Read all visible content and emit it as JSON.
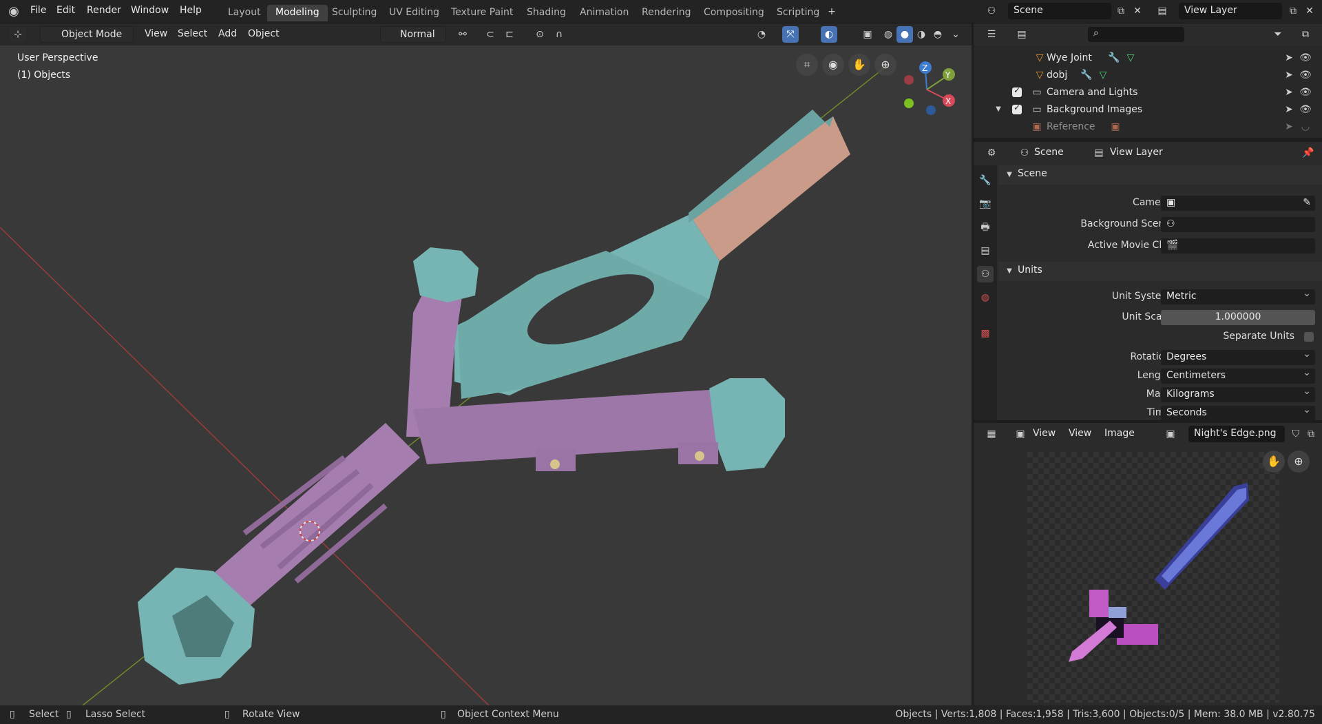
{
  "topbar": {
    "menus": [
      "File",
      "Edit",
      "Render",
      "Window",
      "Help"
    ],
    "workspaces": [
      "Layout",
      "Modeling",
      "Sculpting",
      "UV Editing",
      "Texture Paint",
      "Shading",
      "Animation",
      "Rendering",
      "Compositing",
      "Scripting"
    ],
    "active_workspace": "Modeling",
    "add_tab_icon": "plus-icon",
    "scene": "Scene",
    "view_layer": "View Layer"
  },
  "viewport_header": {
    "mode": "Object Mode",
    "menus": [
      "View",
      "Select",
      "Add",
      "Object"
    ],
    "orientation": "Normal"
  },
  "viewport_overlay": {
    "perspective": "User Perspective",
    "collection": "(1) Objects",
    "gizmo": {
      "x": "X",
      "y": "Y",
      "z": "Z"
    }
  },
  "outliner": {
    "items": [
      {
        "label": "Wye Joint",
        "icon": "mesh-icon"
      },
      {
        "label": "dobj",
        "icon": "mesh-icon"
      },
      {
        "label": "Camera and Lights",
        "icon": "collection-icon"
      },
      {
        "label": "Background Images",
        "icon": "collection-icon"
      },
      {
        "label": "Reference",
        "icon": "image-icon"
      }
    ]
  },
  "properties": {
    "context_scene": "Scene",
    "context_view_layer": "View Layer",
    "scene_section": "Scene",
    "camera_label": "Camera",
    "background_scene_label": "Background Scene",
    "active_movie_clip_label": "Active Movie Clip",
    "units_section": "Units",
    "unit_system_label": "Unit System",
    "unit_system": "Metric",
    "unit_scale_label": "Unit Scale",
    "unit_scale": "1.000000",
    "separate_units_label": "Separate Units",
    "rotation_label": "Rotation",
    "rotation": "Degrees",
    "length_label": "Length",
    "length": "Centimeters",
    "mass_label": "Mass",
    "mass": "Kilograms",
    "time_label": "Time",
    "time": "Seconds"
  },
  "image_editor": {
    "menus": [
      "View",
      "View",
      "Image"
    ],
    "image_name": "Night's Edge.png"
  },
  "statusbar": {
    "select": "Select",
    "lasso": "Lasso Select",
    "rotate": "Rotate View",
    "context_menu": "Object Context Menu",
    "stats": "Objects | Verts:1,808 | Faces:1,958 | Tris:3,600 | Objects:0/5 | Mem: 38.0 MB | v2.80.75"
  },
  "colors": {
    "teal": "#76b5b3",
    "purple": "#a57eaf",
    "salmon": "#c99b88",
    "accent": "#4772b3"
  }
}
